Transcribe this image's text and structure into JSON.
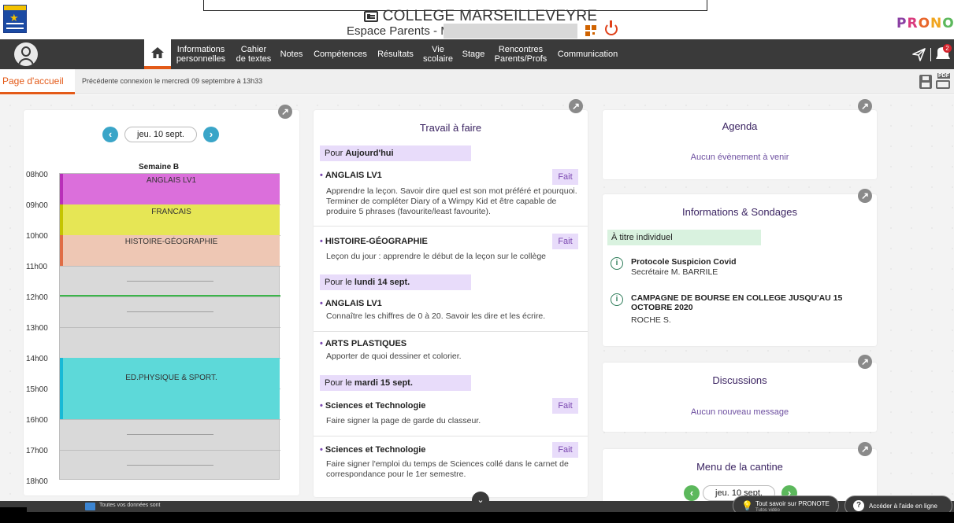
{
  "header": {
    "school_title": "COLLEGE MARSEILLEVEYRE",
    "space": "Espace Parents - M",
    "brand": "PRONOTE"
  },
  "nav": {
    "items": [
      {
        "label": "Informations\npersonnelles"
      },
      {
        "label": "Cahier\nde textes"
      },
      {
        "label": "Notes"
      },
      {
        "label": "Compétences"
      },
      {
        "label": "Résultats"
      },
      {
        "label": "Vie\nscolaire"
      },
      {
        "label": "Stage"
      },
      {
        "label": "Rencontres\nParents/Profs"
      },
      {
        "label": "Communication"
      }
    ],
    "notification_count": "2"
  },
  "crumb": {
    "tab": "Page d'accueil",
    "info": "Précédente connexion le mercredi 09 septembre à 13h33"
  },
  "timetable": {
    "date": "jeu. 10 sept.",
    "week": "Semaine B",
    "hours": [
      "08h00",
      "09h00",
      "10h00",
      "11h00",
      "12h00",
      "13h00",
      "14h00",
      "15h00",
      "16h00",
      "17h00",
      "18h00"
    ],
    "courses": [
      {
        "name": "ANGLAIS LV1",
        "color": "#db6fdb",
        "border": "#b82fb8"
      },
      {
        "name": "FRANCAIS",
        "color": "#e6e655",
        "border": "#c4c400"
      },
      {
        "name": "HISTOIRE-GÉOGRAPHIE",
        "color": "#eec7b4",
        "border": "#e06d45"
      },
      {
        "name": "ED.PHYSIQUE & SPORT.",
        "color": "#5dd9d9",
        "border": "#18b9d6"
      }
    ]
  },
  "homework": {
    "title": "Travail à faire",
    "groups": [
      {
        "prefix": "Pour",
        "day": "Aujourd'hui"
      },
      {
        "prefix": "Pour le",
        "day": "lundi 14 sept."
      },
      {
        "prefix": "Pour le",
        "day": "mardi 15 sept."
      }
    ],
    "items": [
      {
        "subject": "ANGLAIS LV1",
        "text": "Apprendre la leçon. Savoir dire quel est son mot préféré et pourquoi. Terminer de compléter Diary of a Wimpy Kid et être capable de produire 5 phrases (favourite/least favourite).",
        "done": "Fait"
      },
      {
        "subject": "HISTOIRE-GÉOGRAPHIE",
        "text": "Leçon du jour : apprendre le début de la leçon sur le collège",
        "done": "Fait"
      },
      {
        "subject": "ANGLAIS LV1",
        "text": "Connaître les chiffres de 0 à 20. Savoir les dire et les écrire.",
        "done": ""
      },
      {
        "subject": "ARTS PLASTIQUES",
        "text": "Apporter de quoi dessiner et colorier.",
        "done": ""
      },
      {
        "subject": "Sciences et Technologie",
        "text": "Faire signer la page de garde du classeur.",
        "done": "Fait"
      },
      {
        "subject": "Sciences et Technologie",
        "text": "Faire signer l'emploi du temps de Sciences collé dans le carnet de correspondance pour le 1er semestre.",
        "done": "Fait"
      }
    ]
  },
  "agenda": {
    "title": "Agenda",
    "empty": "Aucun évènement à venir"
  },
  "infos": {
    "title": "Informations & Sondages",
    "category": "À titre individuel",
    "items": [
      {
        "title": "Protocole Suspicion Covid",
        "author": "Secrétaire M. BARRILE"
      },
      {
        "title": "CAMPAGNE DE BOURSE EN COLLEGE JUSQU'AU 15 OCTOBRE 2020",
        "author": "ROCHE S."
      }
    ]
  },
  "discussions": {
    "title": "Discussions",
    "empty": "Aucun nouveau message"
  },
  "cantine": {
    "title": "Menu de la cantine",
    "date": "jeu. 10 sept."
  },
  "footer": {
    "text": "Toutes vos données sont",
    "tuto": "Tout savoir sur PRONOTE",
    "tuto_sub": "Tutos vidéo",
    "help": "Accéder à l'aide en ligne"
  }
}
